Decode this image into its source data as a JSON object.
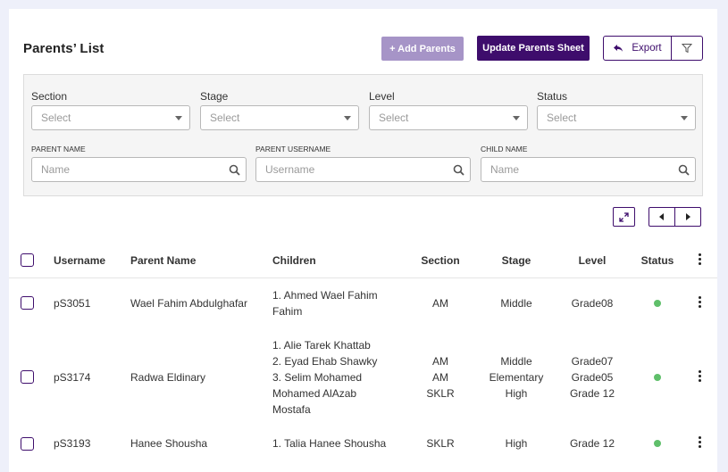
{
  "header": {
    "title": "Parents’ List",
    "add_label": "+ Add Parents",
    "update_label": "Update Parents Sheet",
    "export_label": "Export"
  },
  "filters": {
    "section": {
      "label": "Section",
      "value": "Select"
    },
    "stage": {
      "label": "Stage",
      "value": "Select"
    },
    "level": {
      "label": "Level",
      "value": "Select"
    },
    "status": {
      "label": "Status",
      "value": "Select"
    },
    "parent_name": {
      "label": "PARENT NAME",
      "placeholder": "Name"
    },
    "parent_username": {
      "label": "PARENT USERNAME",
      "placeholder": "Username"
    },
    "child_name": {
      "label": "CHILD NAME",
      "placeholder": "Name"
    }
  },
  "table": {
    "columns": [
      "Username",
      "Parent Name",
      "Children",
      "Section",
      "Stage",
      "Level",
      "Status"
    ],
    "rows": [
      {
        "username": "pS3051",
        "parent_name": "Wael Fahim Abdulghafar",
        "children": [
          "1. Ahmed Wael Fahim",
          "Fahim"
        ],
        "section": [
          "AM"
        ],
        "stage": [
          "Middle"
        ],
        "level": [
          "Grade08"
        ],
        "status_color": "#5fbf6a"
      },
      {
        "username": "pS3174",
        "parent_name": "Radwa Eldinary",
        "children": [
          "1. Alie Tarek Khattab",
          "2. Eyad Ehab Shawky",
          "3. Selim Mohamed",
          "Mohamed AlAzab",
          "Mostafa"
        ],
        "section": [
          "AM",
          "AM",
          "SKLR"
        ],
        "stage": [
          "Middle",
          "Elementary",
          "High"
        ],
        "level": [
          "Grade07",
          "Grade05",
          "Grade 12"
        ],
        "status_color": "#5fbf6a"
      },
      {
        "username": "pS3193",
        "parent_name": "Hanee Shousha",
        "children": [
          "1. Talia Hanee Shousha"
        ],
        "section": [
          "SKLR"
        ],
        "stage": [
          "High"
        ],
        "level": [
          "Grade 12"
        ],
        "status_color": "#5fbf6a"
      }
    ]
  },
  "colors": {
    "accent": "#3e0d6c",
    "accent_light": "#a694c7",
    "status_active": "#5fbf6a",
    "background": "#eef0fa"
  }
}
